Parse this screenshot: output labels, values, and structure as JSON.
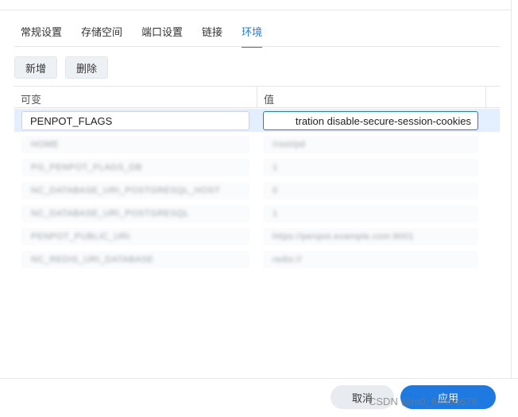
{
  "tabs": [
    {
      "label": "常规设置",
      "active": false
    },
    {
      "label": "存储空间",
      "active": false
    },
    {
      "label": "端口设置",
      "active": false
    },
    {
      "label": "链接",
      "active": false
    },
    {
      "label": "环境",
      "active": true
    }
  ],
  "toolbar": {
    "add_label": "新增",
    "delete_label": "删除"
  },
  "table": {
    "col_variable": "可变",
    "col_value": "值",
    "selected_row": {
      "variable": "PENPOT_FLAGS",
      "value": "tration disable-secure-session-cookies"
    },
    "blurred_rows": [
      {
        "variable": "HOME",
        "value": "/root/pd"
      },
      {
        "variable": "PG_PENPOT_FLAGS_DB",
        "value": "1"
      },
      {
        "variable": "NC_DATABASE_URI_POSTGRESQL_HOST",
        "value": "0"
      },
      {
        "variable": "NC_DATABASE_URI_POSTGRESQL",
        "value": "1"
      },
      {
        "variable": "PENPOT_PUBLIC_URI",
        "value": "https://penpot.example.com:9001"
      },
      {
        "variable": "NC_REDIS_URI_DATABASE",
        "value": "redis://"
      }
    ]
  },
  "footer": {
    "cancel_label": "取消",
    "apply_label": "应用"
  },
  "watermark": "CSDN @m0_64458676",
  "colors": {
    "accent": "#1e7ae0",
    "selected_row": "#e3efff"
  }
}
